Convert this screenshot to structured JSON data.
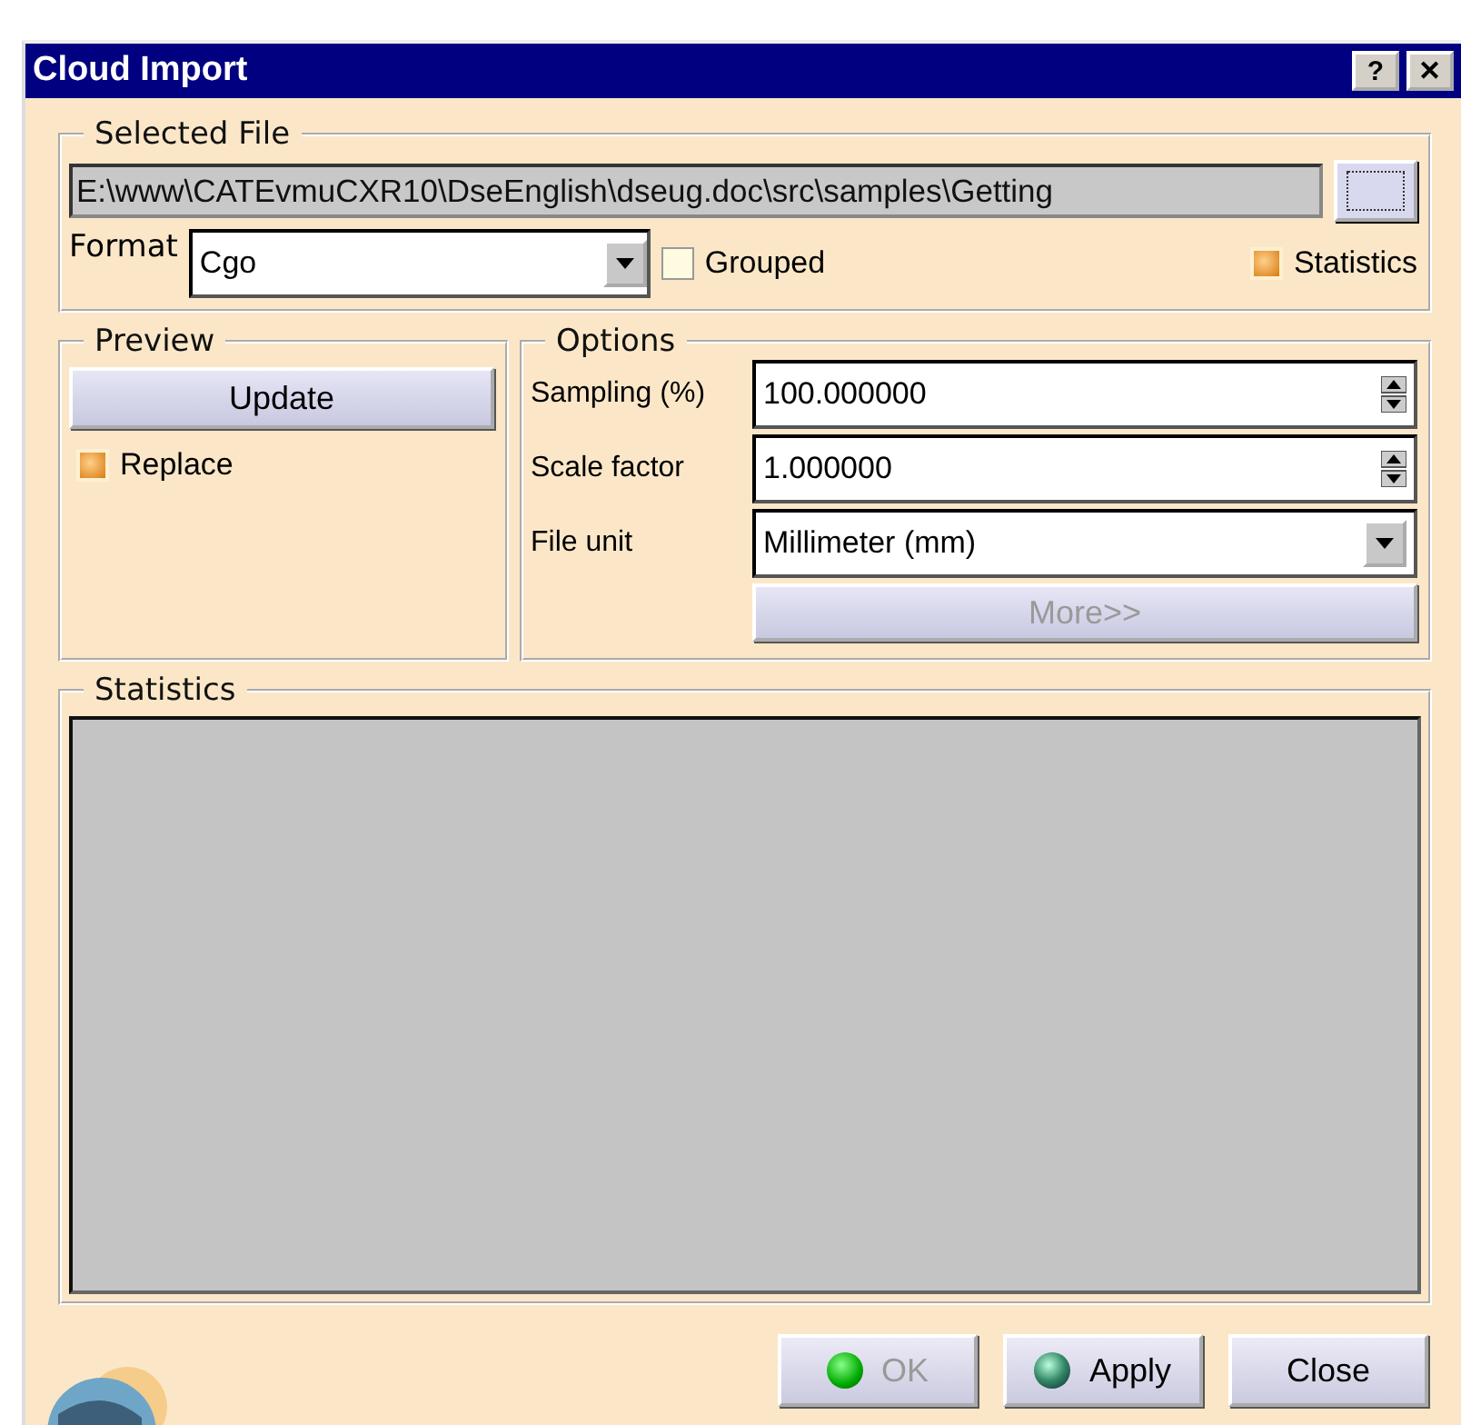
{
  "window": {
    "title": "Cloud Import",
    "title_buttons": [
      "?",
      "✕"
    ]
  },
  "selected_file": {
    "legend": "Selected File",
    "path": "E:\\www\\CATEvmuCXR10\\DseEnglish\\dseug.doc\\src\\samples\\Getting",
    "format_label": "Format",
    "format": "Cgo",
    "grouped": {
      "label": "Grouped",
      "checked": false
    },
    "statistics": {
      "label": "Statistics",
      "checked": true
    }
  },
  "preview": {
    "legend": "Preview",
    "update": "Update",
    "replace": {
      "label": "Replace",
      "checked": true
    }
  },
  "options": {
    "legend": "Options",
    "fields": [
      {
        "kind": "spin",
        "label": "Sampling (%)",
        "value": "100.000000"
      },
      {
        "kind": "spin",
        "label": "Scale factor",
        "value": "1.000000"
      },
      {
        "kind": "combo",
        "label": "File unit",
        "value": "Millimeter (mm)"
      }
    ],
    "more": {
      "label": "More>>",
      "disabled": true
    }
  },
  "statistics": {
    "legend": "Statistics"
  },
  "buttons": [
    {
      "label": "OK",
      "kind": "ball",
      "disabled": true
    },
    {
      "label": "Apply",
      "kind": "ball",
      "disabled": false
    },
    {
      "label": "Close",
      "kind": "plain",
      "disabled": false
    }
  ]
}
